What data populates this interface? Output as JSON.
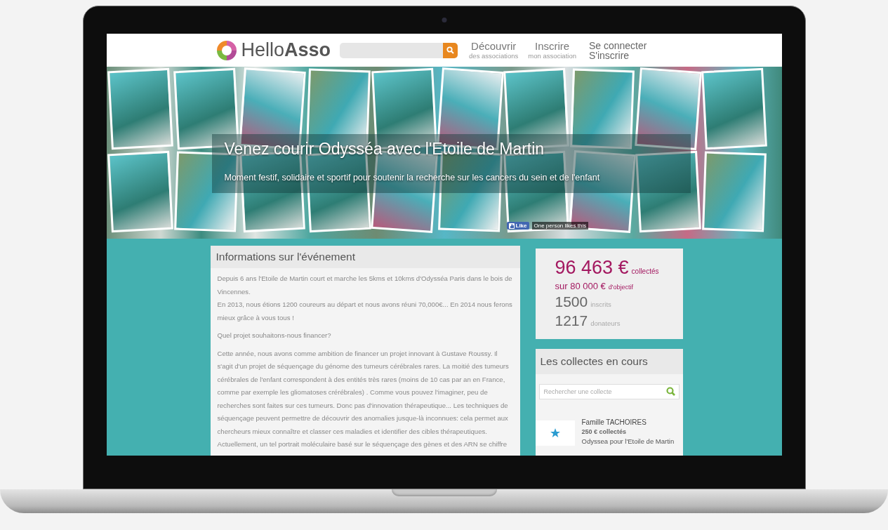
{
  "header": {
    "logo": {
      "light": "Hello",
      "bold": "Asso"
    },
    "nav": [
      {
        "title": "Découvrir",
        "subtitle": "des associations"
      },
      {
        "title": "Inscrire",
        "subtitle": "mon association"
      }
    ],
    "account": [
      "Se connecter",
      "S'inscrire"
    ]
  },
  "hero": {
    "title": "Venez courir Odysséa avec l'Etoile de Martin",
    "subtitle": "Moment festif, solidaire et sportif pour soutenir la recherche sur les cancers du sein et de l'enfant",
    "like_button": "Like",
    "like_text": "One person likes this"
  },
  "info": {
    "title": "Informations sur l'événement",
    "paragraphs": [
      [
        "Depuis 6 ans l'Etoile de Martin court et marche les 5kms et 10kms d'Odysséa Paris dans le bois de Vincennes.",
        "En 2013, nous étions 1200 coureurs au départ et nous avons réuni 70,000€... En 2014 nous ferons mieux grâce à vous tous !"
      ],
      [
        "Quel projet souhaitons-nous financer?"
      ],
      [
        "Cette année, nous avons comme ambition de financer un projet innovant à Gustave Roussy. Il s'agit d'un projet de séquençage du génome des tumeurs cérébrales rares. La moitié des tumeurs cérébrales de l'enfant correspondent à des entités très rares (moins de 10 cas par an en France, comme par exemple les gliomatoses crérébrales) . Comme vous pouvez l'imaginer, peu de recherches sont faites sur ces tumeurs. Donc pas d'innovation thérapeutique... Les techniques de séquençage peuvent permettre de découvrir des anomalies jusque-là inconnues: cela permet aux chercheurs mieux connaître et classer ces maladies et identifier des cibles thérapeutiques. Actuellement, un tel portrait moléculaire basé sur le séquençage des gènes et des ARN se chiffre"
      ]
    ]
  },
  "stats": {
    "raised": {
      "value": "96 463 €",
      "label": "collectés"
    },
    "goal": {
      "value": "sur 80 000 €",
      "label": "d'objectif"
    },
    "counts": [
      {
        "value": "1500",
        "label": "inscrits"
      },
      {
        "value": "1217",
        "label": "donateurs"
      }
    ]
  },
  "collectes": {
    "title": "Les collectes en cours",
    "search": {
      "placeholder": "Rechercher une collecte"
    },
    "items": [
      {
        "name": "Famille TACHOIRES",
        "amount": "250 € collectés",
        "event": "Odyssea pour l'Etoile de Martin"
      }
    ]
  }
}
